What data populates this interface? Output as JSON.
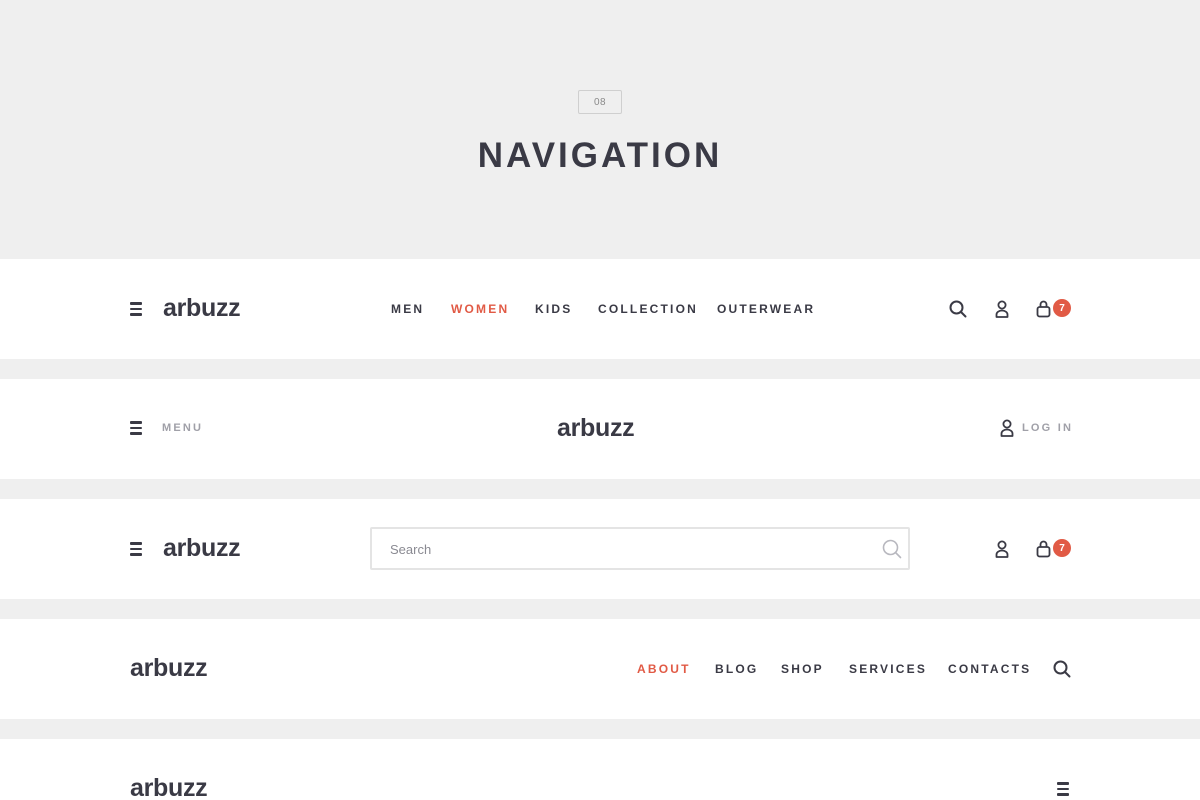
{
  "hero": {
    "badge": "08",
    "title": "NAVIGATION"
  },
  "colors": {
    "accent": "#e15a45",
    "text": "#3a3a45",
    "muted": "#a0a0a8",
    "background": "#efefef",
    "bar": "#ffffff"
  },
  "bar1": {
    "menu_icon": "hamburger-icon",
    "logo": "arbuzz",
    "nav": [
      "MEN",
      "WOMEN",
      "KIDS",
      "COLLECTION",
      "OUTERWEAR"
    ],
    "active_nav": "WOMEN",
    "icons": [
      "search-icon",
      "user-icon",
      "bag-icon"
    ],
    "cart_count": "7"
  },
  "bar2": {
    "menu_icon": "hamburger-icon",
    "menu_label": "MENU",
    "logo": "arbuzz",
    "login_icon": "user-icon",
    "login_label": "LOG IN"
  },
  "bar3": {
    "menu_icon": "hamburger-icon",
    "logo": "arbuzz",
    "search_placeholder": "Search",
    "search_value": "",
    "icons": [
      "search-icon",
      "user-icon",
      "bag-icon"
    ],
    "cart_count": "7"
  },
  "bar4": {
    "logo": "arbuzz",
    "nav": [
      "ABOUT",
      "BLOG",
      "SHOP",
      "SERVICES",
      "CONTACTS"
    ],
    "active_nav": "ABOUT",
    "icons": [
      "search-icon"
    ]
  },
  "bar5": {
    "logo": "arbuzz",
    "menu_icon": "hamburger-icon"
  }
}
